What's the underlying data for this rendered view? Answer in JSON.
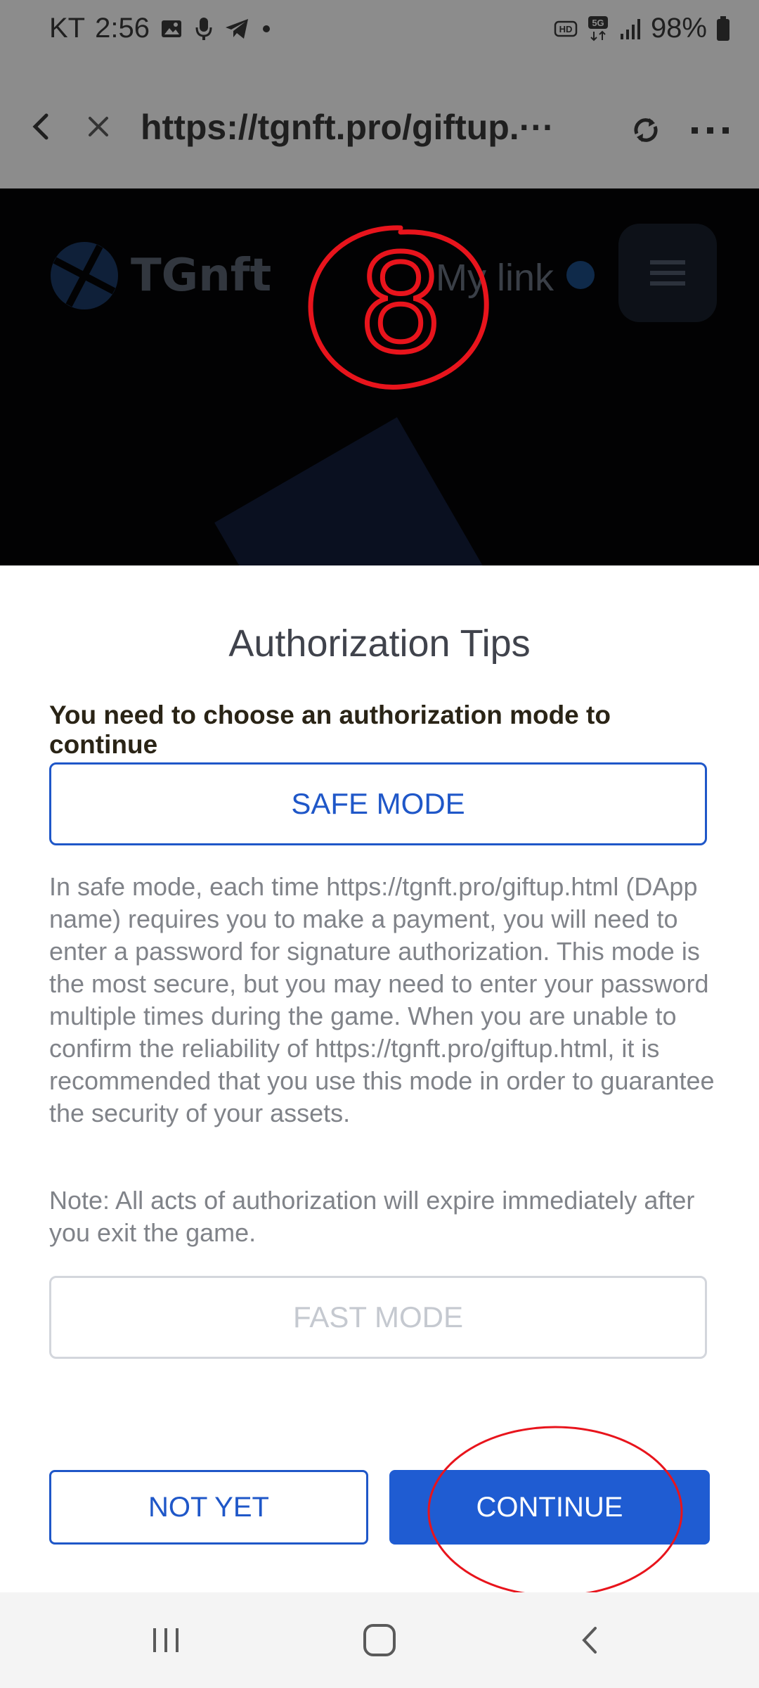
{
  "status_bar": {
    "carrier": "KT",
    "time": "2:56",
    "battery": "98%",
    "icons_left": [
      "gallery-icon",
      "mic-icon",
      "telegram-icon",
      "dot-icon"
    ],
    "icons_right": [
      "hd-icon",
      "5g-icon",
      "signal-icon",
      "battery-icon"
    ]
  },
  "browser": {
    "url": "https://tgnft.pro/giftup.",
    "url_ellipsis": "···"
  },
  "web": {
    "logo_text": "TGnft",
    "my_link": "My link",
    "annotation_number": "8"
  },
  "dialog": {
    "title": "Authorization Tips",
    "subtitle": "You need to choose an authorization mode to continue",
    "safe_mode_label": "SAFE MODE",
    "description": "In safe mode, each time https://tgnft.pro/giftup.html (DApp name) requires you to make a payment, you will need to enter a password for signature authorization. This mode is the most secure, but you may need to enter your password multiple times during the game. When you are unable to confirm the reliability of https://tgnft.pro/giftup.html, it is recommended that you use this mode in order to guarantee the security of your assets.",
    "note": "Note: All acts of authorization will expire immediately after you exit the game.",
    "fast_mode_label": "FAST MODE",
    "not_yet_label": "NOT YET",
    "continue_label": "CONTINUE"
  },
  "colors": {
    "primary": "#1f5cd2",
    "annotation": "#e8141c",
    "overlay": "#8c8c8c"
  }
}
